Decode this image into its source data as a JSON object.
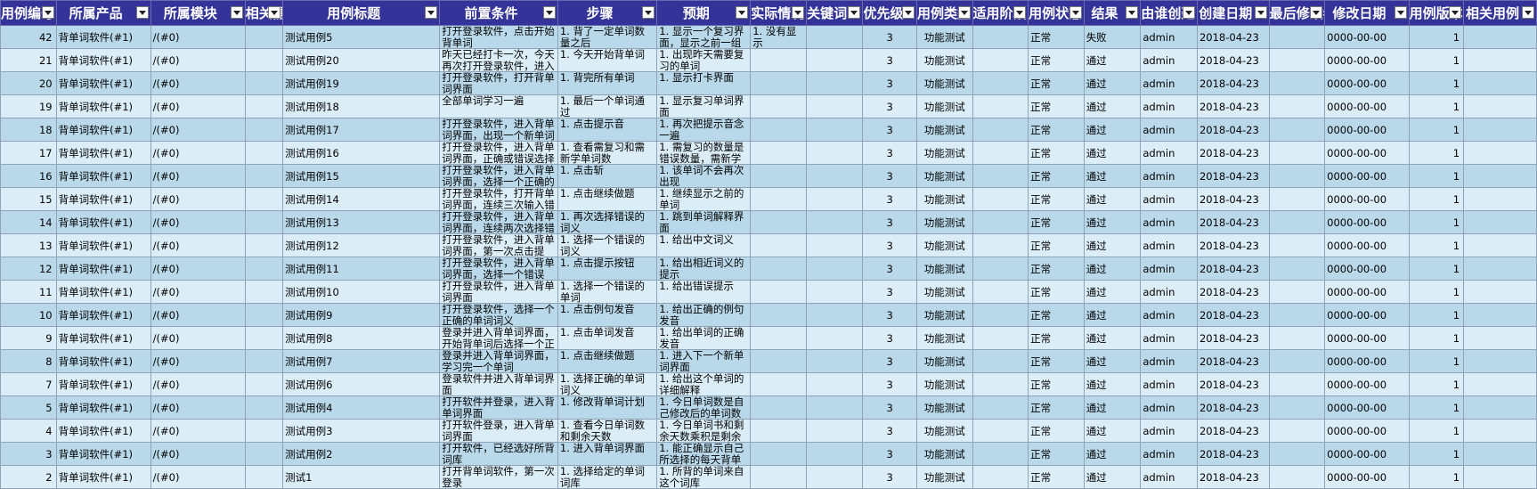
{
  "columns": [
    "用例编号",
    "所属产品",
    "所属模块",
    "相关需求",
    "用例标题",
    "前置条件",
    "步骤",
    "预期",
    "实际情况",
    "关键词",
    "优先级",
    "用例类型",
    "适用阶段",
    "用例状态",
    "结果",
    "由谁创建",
    "创建日期",
    "最后修改者",
    "修改日期",
    "用例版本",
    "相关用例"
  ],
  "rows": [
    {
      "id": "42",
      "product": "背单词软件(#1)",
      "module": "/(#0)",
      "title": "测试用例5",
      "pre": "打开登录软件，点击开始背单词",
      "steps": "1. 背了一定单词数量之后",
      "expect": "1. 显示一个复习界面，显示之前一组",
      "actual": "1. 没有显示",
      "priority": "3",
      "type": "功能测试",
      "status": "正常",
      "result": "失败",
      "creator": "admin",
      "date": "2018-04-23",
      "mdate": "0000-00-00",
      "ver": "1"
    },
    {
      "id": "21",
      "product": "背单词软件(#1)",
      "module": "/(#0)",
      "title": "测试用例20",
      "pre": "昨天已经打卡一次，今天再次打开登录软件，进入",
      "steps": "1. 今天开始背单词",
      "expect": "1. 出现昨天需要复习的单词",
      "actual": "",
      "priority": "3",
      "type": "功能测试",
      "status": "正常",
      "result": "通过",
      "creator": "admin",
      "date": "2018-04-23",
      "mdate": "0000-00-00",
      "ver": "1"
    },
    {
      "id": "20",
      "product": "背单词软件(#1)",
      "module": "/(#0)",
      "title": "测试用例19",
      "pre": "打开登录软件，打开背单词界面",
      "steps": "1. 背完所有单词",
      "expect": "1. 显示打卡界面",
      "actual": "",
      "priority": "3",
      "type": "功能测试",
      "status": "正常",
      "result": "通过",
      "creator": "admin",
      "date": "2018-04-23",
      "mdate": "0000-00-00",
      "ver": "1"
    },
    {
      "id": "19",
      "product": "背单词软件(#1)",
      "module": "/(#0)",
      "title": "测试用例18",
      "pre": "全部单词学习一遍",
      "steps": "1. 最后一个单词通过",
      "expect": "1. 显示复习单词界面",
      "actual": "",
      "priority": "3",
      "type": "功能测试",
      "status": "正常",
      "result": "通过",
      "creator": "admin",
      "date": "2018-04-23",
      "mdate": "0000-00-00",
      "ver": "1"
    },
    {
      "id": "18",
      "product": "背单词软件(#1)",
      "module": "/(#0)",
      "title": "测试用例17",
      "pre": "打开登录软件，进入背单词界面，出现一个新单词",
      "steps": "1. 点击提示音",
      "expect": "1. 再次把提示音念一遍",
      "actual": "",
      "priority": "3",
      "type": "功能测试",
      "status": "正常",
      "result": "通过",
      "creator": "admin",
      "date": "2018-04-23",
      "mdate": "0000-00-00",
      "ver": "1"
    },
    {
      "id": "17",
      "product": "背单词软件(#1)",
      "module": "/(#0)",
      "title": "测试用例16",
      "pre": "打开登录软件，进入背单词界面，正确或错误选择",
      "steps": "1. 查看需复习和需新学单词数",
      "expect": "1. 需复习的数量是错误数量，需新学",
      "actual": "",
      "priority": "3",
      "type": "功能测试",
      "status": "正常",
      "result": "通过",
      "creator": "admin",
      "date": "2018-04-23",
      "mdate": "0000-00-00",
      "ver": "1"
    },
    {
      "id": "16",
      "product": "背单词软件(#1)",
      "module": "/(#0)",
      "title": "测试用例15",
      "pre": "打开登录软件，进入背单词界面，选择一个正确的",
      "steps": "1. 点击斩",
      "expect": "1. 该单词不会再次出现",
      "actual": "",
      "priority": "3",
      "type": "功能测试",
      "status": "正常",
      "result": "通过",
      "creator": "admin",
      "date": "2018-04-23",
      "mdate": "0000-00-00",
      "ver": "1"
    },
    {
      "id": "15",
      "product": "背单词软件(#1)",
      "module": "/(#0)",
      "title": "测试用例14",
      "pre": "打开登录软件，打开背单词界面，连续三次输入错",
      "steps": "1. 点击继续做题",
      "expect": "1. 继续显示之前的单词",
      "actual": "",
      "priority": "3",
      "type": "功能测试",
      "status": "正常",
      "result": "通过",
      "creator": "admin",
      "date": "2018-04-23",
      "mdate": "0000-00-00",
      "ver": "1"
    },
    {
      "id": "14",
      "product": "背单词软件(#1)",
      "module": "/(#0)",
      "title": "测试用例13",
      "pre": "打开登录软件，进入背单词界面，连续两次选择错",
      "steps": "1. 再次选择错误的词义",
      "expect": "1. 跳到单词解释界面",
      "actual": "",
      "priority": "3",
      "type": "功能测试",
      "status": "正常",
      "result": "通过",
      "creator": "admin",
      "date": "2018-04-23",
      "mdate": "0000-00-00",
      "ver": "1"
    },
    {
      "id": "13",
      "product": "背单词软件(#1)",
      "module": "/(#0)",
      "title": "测试用例12",
      "pre": "打开登录软件，进入背单词界面，第一次点击提",
      "steps": "1. 选择一个错误的词义",
      "expect": "1. 给出中文词义",
      "actual": "",
      "priority": "3",
      "type": "功能测试",
      "status": "正常",
      "result": "通过",
      "creator": "admin",
      "date": "2018-04-23",
      "mdate": "0000-00-00",
      "ver": "1"
    },
    {
      "id": "12",
      "product": "背单词软件(#1)",
      "module": "/(#0)",
      "title": "测试用例11",
      "pre": "打开登录软件，进入背单词界面，选择一个错误",
      "steps": "1. 点击提示按钮",
      "expect": "1. 给出相近词义的提示",
      "actual": "",
      "priority": "3",
      "type": "功能测试",
      "status": "正常",
      "result": "通过",
      "creator": "admin",
      "date": "2018-04-23",
      "mdate": "0000-00-00",
      "ver": "1"
    },
    {
      "id": "11",
      "product": "背单词软件(#1)",
      "module": "/(#0)",
      "title": "测试用例10",
      "pre": "打开登录软件，进入背单词界面",
      "steps": "1. 选择一个错误的单词",
      "expect": "1. 给出错误提示",
      "actual": "",
      "priority": "3",
      "type": "功能测试",
      "status": "正常",
      "result": "通过",
      "creator": "admin",
      "date": "2018-04-23",
      "mdate": "0000-00-00",
      "ver": "1"
    },
    {
      "id": "10",
      "product": "背单词软件(#1)",
      "module": "/(#0)",
      "title": "测试用例9",
      "pre": "打开登录软件，选择一个正确的单词词义",
      "steps": "1. 点击例句发音",
      "expect": "1. 给出正确的例句发音",
      "actual": "",
      "priority": "3",
      "type": "功能测试",
      "status": "正常",
      "result": "通过",
      "creator": "admin",
      "date": "2018-04-23",
      "mdate": "0000-00-00",
      "ver": "1"
    },
    {
      "id": "9",
      "product": "背单词软件(#1)",
      "module": "/(#0)",
      "title": "测试用例8",
      "pre": "登录并进入背单词界面，开始背单词后选择一个正",
      "steps": "1. 点击单词发音",
      "expect": "1. 给出单词的正确发音",
      "actual": "",
      "priority": "3",
      "type": "功能测试",
      "status": "正常",
      "result": "通过",
      "creator": "admin",
      "date": "2018-04-23",
      "mdate": "0000-00-00",
      "ver": "1"
    },
    {
      "id": "8",
      "product": "背单词软件(#1)",
      "module": "/(#0)",
      "title": "测试用例7",
      "pre": "登录并进入背单词界面，学习完一个单词",
      "steps": "1. 点击继续做题",
      "expect": "1. 进入下一个新单词界面",
      "actual": "",
      "priority": "3",
      "type": "功能测试",
      "status": "正常",
      "result": "通过",
      "creator": "admin",
      "date": "2018-04-23",
      "mdate": "0000-00-00",
      "ver": "1"
    },
    {
      "id": "7",
      "product": "背单词软件(#1)",
      "module": "/(#0)",
      "title": "测试用例6",
      "pre": "登录软件并进入背单词界面",
      "steps": "1. 选择正确的单词词义",
      "expect": "1. 给出这个单词的详细解释",
      "actual": "",
      "priority": "3",
      "type": "功能测试",
      "status": "正常",
      "result": "通过",
      "creator": "admin",
      "date": "2018-04-23",
      "mdate": "0000-00-00",
      "ver": "1"
    },
    {
      "id": "5",
      "product": "背单词软件(#1)",
      "module": "/(#0)",
      "title": "测试用例4",
      "pre": "打开软件并登录，进入背单词界面",
      "steps": "1. 修改背单词计划",
      "expect": "1. 今日单词数是自己修改后的单词数",
      "actual": "",
      "priority": "3",
      "type": "功能测试",
      "status": "正常",
      "result": "通过",
      "creator": "admin",
      "date": "2018-04-23",
      "mdate": "0000-00-00",
      "ver": "1"
    },
    {
      "id": "4",
      "product": "背单词软件(#1)",
      "module": "/(#0)",
      "title": "测试用例3",
      "pre": "打开软件登录，进入背单词界面",
      "steps": "1. 查看今日单词数和剩余天数",
      "expect": "1. 今日单词书和剩余天数乘积是剩余",
      "actual": "",
      "priority": "3",
      "type": "功能测试",
      "status": "正常",
      "result": "通过",
      "creator": "admin",
      "date": "2018-04-23",
      "mdate": "0000-00-00",
      "ver": "1"
    },
    {
      "id": "3",
      "product": "背单词软件(#1)",
      "module": "/(#0)",
      "title": "测试用例2",
      "pre": "打开软件，已经选好所背词库",
      "steps": "1. 进入背单词界面",
      "expect": "1. 能正确显示自己所选择的每天背单",
      "actual": "",
      "priority": "3",
      "type": "功能测试",
      "status": "正常",
      "result": "通过",
      "creator": "admin",
      "date": "2018-04-23",
      "mdate": "0000-00-00",
      "ver": "1"
    },
    {
      "id": "2",
      "product": "背单词软件(#1)",
      "module": "/(#0)",
      "title": "测试1",
      "pre": "打开背单词软件，第一次登录",
      "steps": "1. 选择给定的单词词库",
      "expect": "1. 所背的单词来自这个词库",
      "actual": "",
      "priority": "3",
      "type": "功能测试",
      "status": "正常",
      "result": "通过",
      "creator": "admin",
      "date": "2018-04-23",
      "mdate": "0000-00-00",
      "ver": "1"
    }
  ]
}
